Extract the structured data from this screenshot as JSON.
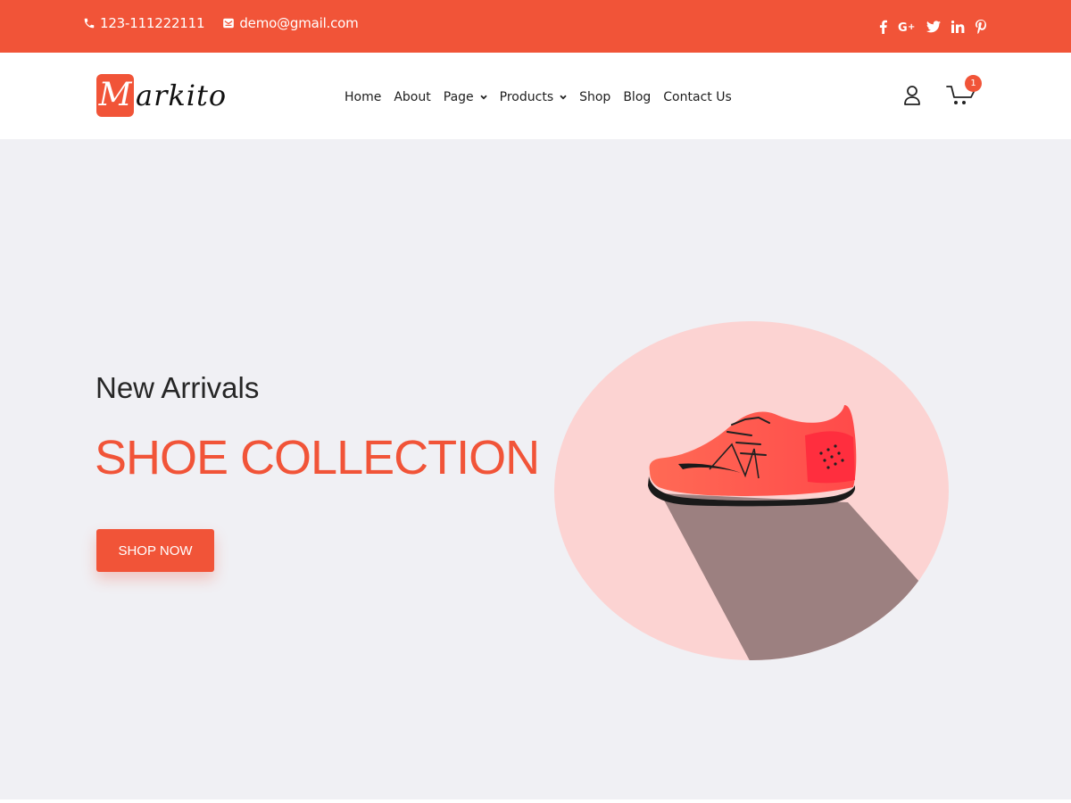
{
  "topbar": {
    "phone": "123-111222111",
    "email": "demo@gmail.com",
    "socials": [
      {
        "name": "facebook",
        "glyph": "f"
      },
      {
        "name": "google-plus",
        "glyph": "G+"
      },
      {
        "name": "twitter",
        "glyph": "t"
      },
      {
        "name": "linkedin",
        "glyph": "in"
      },
      {
        "name": "pinterest",
        "glyph": "p"
      }
    ]
  },
  "header": {
    "logo": {
      "initial": "M",
      "rest": "arkito"
    },
    "nav": {
      "home": "Home",
      "about": "About",
      "page": "Page",
      "products": "Products",
      "shop": "Shop",
      "blog": "Blog",
      "contact": "Contact Us"
    },
    "cart_count": "1"
  },
  "hero": {
    "subtitle": "New Arrivals",
    "title": "SHOE COLLECTION",
    "button": "SHOP NOW"
  },
  "colors": {
    "accent": "#f15438",
    "hero_bg": "#f0f0f4",
    "circle": "#fcd3d2",
    "shadow": "#9c8080"
  },
  "icons": [
    "phone-icon",
    "email-icon",
    "facebook-icon",
    "google-plus-icon",
    "twitter-icon",
    "linkedin-icon",
    "pinterest-icon",
    "user-icon",
    "cart-icon",
    "chevron-down-icon"
  ]
}
